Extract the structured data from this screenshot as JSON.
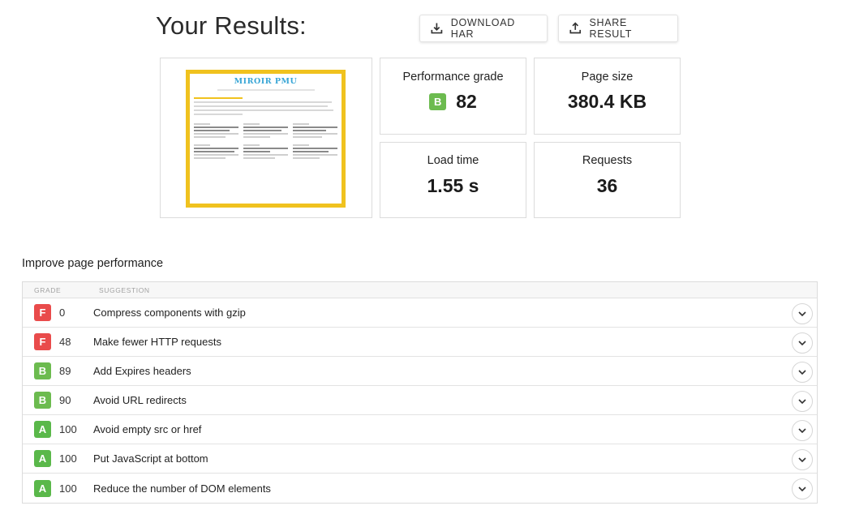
{
  "header": {
    "title": "Your Results:",
    "download_label": "DOWNLOAD HAR",
    "share_label": "SHARE RESULT"
  },
  "thumbnail": {
    "site_name": "MIROIR PMU"
  },
  "metrics": {
    "grade": {
      "label": "Performance grade",
      "letter": "B",
      "value": "82"
    },
    "page_size": {
      "label": "Page size",
      "value": "380.4 KB"
    },
    "load_time": {
      "label": "Load time",
      "value": "1.55 s"
    },
    "requests": {
      "label": "Requests",
      "value": "36"
    }
  },
  "improve": {
    "title": "Improve page performance",
    "columns": {
      "grade": "GRADE",
      "suggestion": "SUGGESTION"
    },
    "rows": [
      {
        "letter": "F",
        "score": "0",
        "suggestion": "Compress components with gzip"
      },
      {
        "letter": "F",
        "score": "48",
        "suggestion": "Make fewer HTTP requests"
      },
      {
        "letter": "B",
        "score": "89",
        "suggestion": "Add Expires headers"
      },
      {
        "letter": "B",
        "score": "90",
        "suggestion": "Avoid URL redirects"
      },
      {
        "letter": "A",
        "score": "100",
        "suggestion": "Avoid empty src or href"
      },
      {
        "letter": "A",
        "score": "100",
        "suggestion": "Put JavaScript at bottom"
      },
      {
        "letter": "A",
        "score": "100",
        "suggestion": "Reduce the number of DOM elements"
      }
    ]
  },
  "icons": {
    "download": "download-icon",
    "share": "share-icon",
    "expand": "chevron-down-icon"
  },
  "colors": {
    "grade_a": "#5ab84a",
    "grade_b": "#6cbb4f",
    "grade_f": "#e94b4b",
    "thumbnail_border": "#f0c21e",
    "thumbnail_brand": "#39a6d6"
  }
}
